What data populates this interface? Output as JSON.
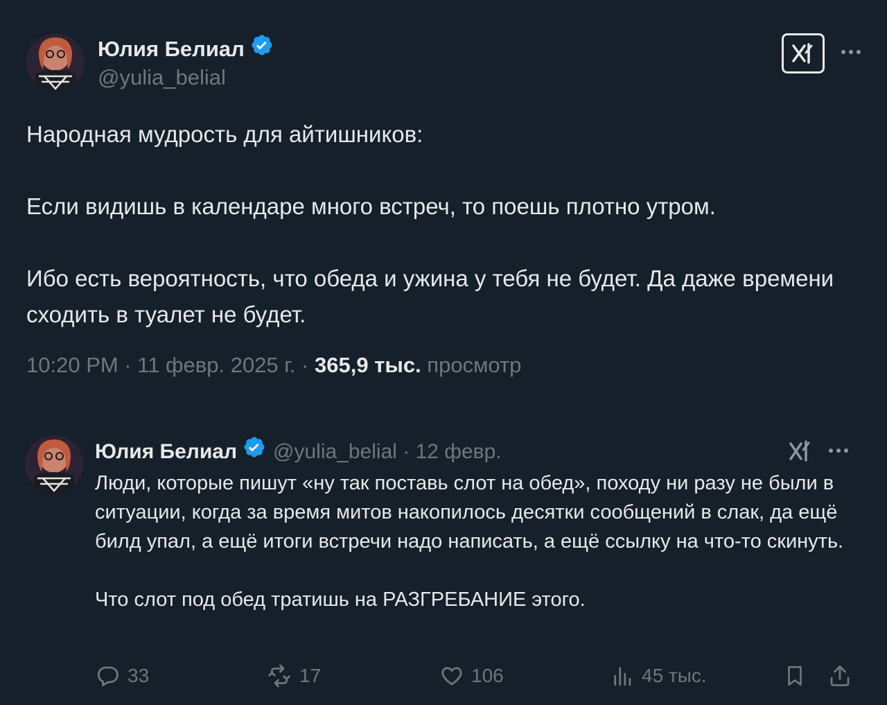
{
  "colors": {
    "background": "#16202a",
    "text_primary": "#e7e9ea",
    "text_secondary": "#71767b",
    "verified_blue": "#1d9bf0"
  },
  "main_tweet": {
    "author_name": "Юлия Белиал",
    "handle": "@yulia_belial",
    "verified_icon": "verified-badge-icon",
    "avatar_icon": "avatar-image",
    "grok_icon": "grok-icon",
    "more_icon": "more-options-icon",
    "text": "Народная мудрость для айтишников:\n\nЕсли видишь в календаре много встреч, то поешь плотно утром.\n\nИбо есть вероятность, что обеда и ужина у тебя не будет. Да даже времени сходить в туалет не будет.",
    "time": "10:20 PM · 11 февр. 2025 г. · ",
    "views_count": "365,9 тыс.",
    "views_label": " просмотр"
  },
  "reply": {
    "author_name": "Юлия Белиал",
    "handle_date": "@yulia_belial · 12 февр.",
    "text": "Люди, которые пишут «ну так поставь слот на обед», походу ни разу не были в ситуации, когда за время митов накопилось десятки сообщений в слак, да ещё билд упал, а ещё итоги встречи надо написать, а ещё ссылку на что-то скинуть.\n\nЧто слот под обед тратишь на РАЗГРЕБАНИЕ этого.",
    "actions": {
      "replies": "33",
      "reposts": "17",
      "likes": "106",
      "views": "45 тыс."
    },
    "action_icons": [
      "reply-icon",
      "repost-icon",
      "like-icon",
      "views-icon",
      "bookmark-icon",
      "share-icon"
    ]
  }
}
